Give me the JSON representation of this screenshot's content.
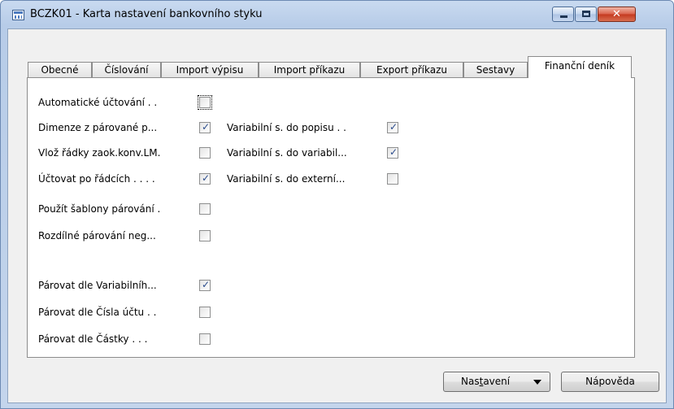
{
  "window": {
    "title": "BCZK01 - Karta nastavení bankovního styku",
    "icon": "form-icon",
    "controls": {
      "minimize": "minimize-icon",
      "maximize": "maximize-icon",
      "close": "close-icon"
    }
  },
  "tabs": [
    {
      "label": "Obecné",
      "active": false
    },
    {
      "label": "Číslování",
      "active": false
    },
    {
      "label": "Import výpisu",
      "active": false
    },
    {
      "label": "Import příkazu",
      "active": false
    },
    {
      "label": "Export příkazu",
      "active": false
    },
    {
      "label": "Sestavy",
      "active": false
    },
    {
      "label": "Finanční deník",
      "active": true
    }
  ],
  "left_fields": [
    {
      "label": "Automatické účtování . .",
      "checked": false,
      "focused": true
    },
    {
      "label": "Dimenze z párované p...",
      "checked": true
    },
    {
      "label": "Vlož řádky zaok.konv.LM.",
      "checked": false
    },
    {
      "label": "Účtovat po řádcích . . . .",
      "checked": true
    },
    {
      "label": "Použít šablony párování .",
      "checked": false
    },
    {
      "label": "Rozdílné párování neg...",
      "checked": false
    },
    {
      "label": "Párovat dle Variabilníh...",
      "checked": true
    },
    {
      "label": "Párovat dle Čísla účtu . .",
      "checked": false
    },
    {
      "label": "Párovat dle Částky . . .",
      "checked": false
    }
  ],
  "right_fields": [
    {
      "label": "Variabilní s. do popisu . .",
      "checked": true
    },
    {
      "label": "Variabilní s. do variabil...",
      "checked": true
    },
    {
      "label": "Variabilní s. do externí...",
      "checked": false
    }
  ],
  "buttons": {
    "settings": {
      "pre": "Nas",
      "underlined": "t",
      "post": "avení"
    },
    "settings_caret": "dropdown-caret-icon",
    "help": "Nápověda"
  },
  "colors": {
    "check": "#2b4c8c",
    "close_button": "#c4391f",
    "titlebar": "#b7cce8"
  }
}
